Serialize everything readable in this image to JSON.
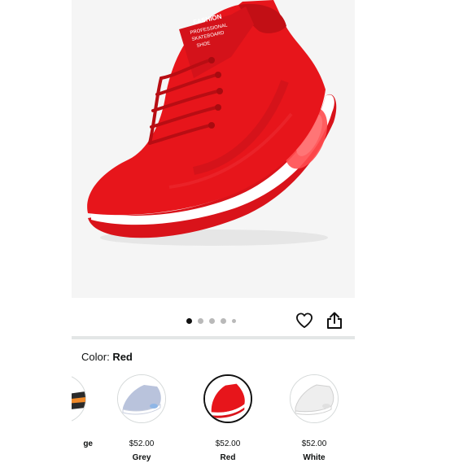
{
  "gallery": {
    "image": "red-knit-running-sneaker",
    "shoe_tongue_text": [
      "FASHION",
      "PROFESSIONAL",
      "SKATEBOARD",
      "SHOE"
    ],
    "dots_total": 5,
    "dots_active_index": 0
  },
  "actions": {
    "favorite_icon": "heart-icon",
    "share_icon": "share-icon"
  },
  "color": {
    "label": "Color:",
    "selected": "Red"
  },
  "swatches": [
    {
      "name": "ge",
      "price": "",
      "color": "#ffffff",
      "accent": "#f08a2a"
    },
    {
      "name": "Grey",
      "price": "$52.00",
      "color": "#b9c3dc"
    },
    {
      "name": "Red",
      "price": "$52.00",
      "color": "#e7151b",
      "selected": true
    },
    {
      "name": "White",
      "price": "$52.00",
      "color": "#f3f3f3"
    }
  ],
  "colors": {
    "shoe_red": "#e7151b",
    "text": "#0f1111",
    "dot_active": "#111111",
    "dot_inactive": "#b9b9b9"
  }
}
